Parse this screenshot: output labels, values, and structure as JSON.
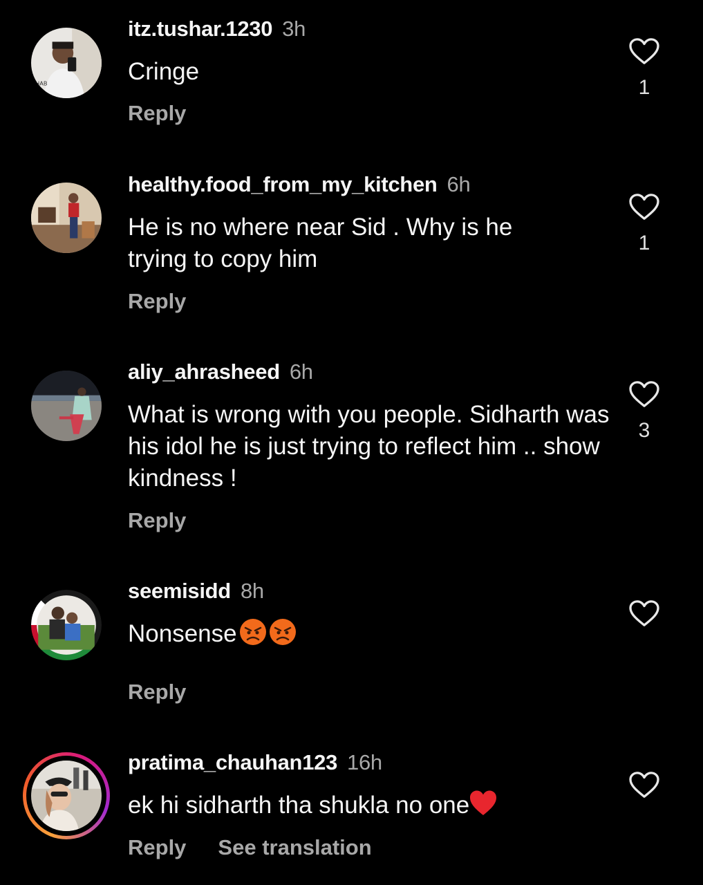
{
  "colors": {
    "background": "#000000",
    "text_primary": "#f5f5f5",
    "text_secondary": "#a8a8a8",
    "heart_emoji": "#e8262e",
    "angry_emoji": "#f26a1b"
  },
  "comments": [
    {
      "username": "itz.tushar.1230",
      "time": "3h",
      "text": "Cringe",
      "reply_label": "Reply",
      "like_count": "1",
      "like_icon": "heart-outline-icon"
    },
    {
      "username": "healthy.food_from_my_kitchen",
      "time": "6h",
      "text": "He is no where near Sid . Why is he trying to copy him",
      "reply_label": "Reply",
      "like_count": "1",
      "like_icon": "heart-outline-icon"
    },
    {
      "username": "aliy_ahrasheed",
      "time": "6h",
      "text": "What is wrong with you people. Sidharth was his idol he is just trying to reflect him .. show kindness !",
      "reply_label": "Reply",
      "like_count": "3",
      "like_icon": "heart-outline-icon"
    },
    {
      "username": "seemisidd",
      "time": "8h",
      "text": "Nonsense",
      "emojis": [
        "angry-face-emoji",
        "angry-face-emoji"
      ],
      "reply_label": "Reply",
      "like_icon": "heart-outline-icon"
    },
    {
      "username": "pratima_chauhan123",
      "time": "16h",
      "text": "ek hi sidharth tha shukla no one",
      "emojis": [
        "red-heart-emoji"
      ],
      "reply_label": "Reply",
      "translation_label": "See translation",
      "like_icon": "heart-outline-icon"
    }
  ]
}
